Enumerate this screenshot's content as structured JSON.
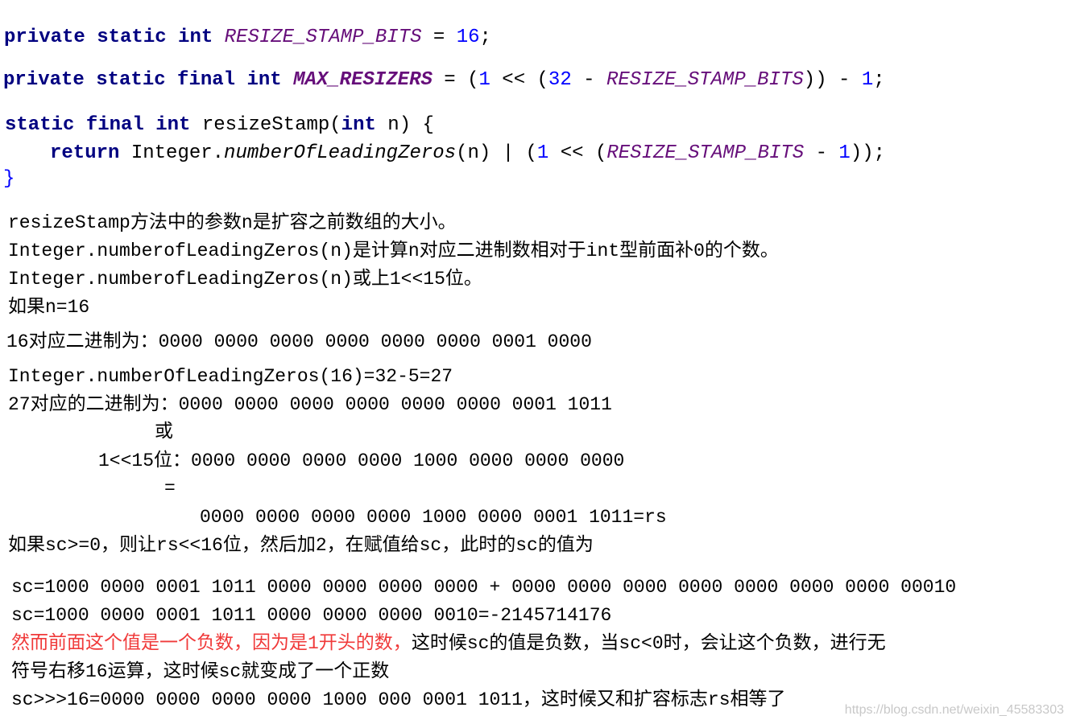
{
  "code": {
    "line1": {
      "kw": "private static int ",
      "const": "RESIZE_STAMP_BITS",
      "eq": " = ",
      "num": "16",
      "end": ";"
    },
    "line2": {
      "kw": "private static final int ",
      "const": "MAX_RESIZERS",
      "p1": " = (",
      "n1": "1",
      "p2": " << (",
      "n2": "32",
      "p3": " - ",
      "const2": "RESIZE_STAMP_BITS",
      "p4": ")) - ",
      "n3": "1",
      "end": ";"
    },
    "line3": {
      "kw": "static final int ",
      "name": "resizeStamp(",
      "kw2": "int",
      "rest": " n) {"
    },
    "line4": {
      "kw": "return ",
      "cls": "Integer.",
      "method": "numberOfLeadingZeros",
      "p1": "(n) | (",
      "n1": "1",
      "p2": " << (",
      "const": "RESIZE_STAMP_BITS",
      "p3": " - ",
      "n2": "1",
      "end": "));"
    },
    "line5": "}"
  },
  "text": [
    "resizeStamp方法中的参数n是扩容之前数组的大小。",
    "Integer.numberofLeadingZeros(n)是计算n对应二进制数相对于int型前面补0的个数。",
    "Integer.numberofLeadingZeros(n)或上1<<15位。",
    "如果n=16",
    "16对应二进制为：0000 0000 0000 0000 0000 0000 0001 0000",
    "Integer.numberOfLeadingZeros(16)=32-5=27",
    "27对应的二进制为：0000 0000 0000 0000 0000 0000 0001 1011",
    "或",
    "1<<15位：0000 0000 0000 0000 1000 0000 0000 0000",
    "=",
    "0000 0000 0000 0000 1000 0000 0001 1011=rs",
    "如果sc>=0，则让rs<<16位，然后加2，在赋值给sc，此时的sc的值为",
    "sc=1000 0000 0001 1011 0000 0000 0000 0000 + 0000 0000 0000 0000 0000 0000 0000 00010",
    "sc=1000 0000 0001 1011 0000 0000 0000 0010=-2145714176"
  ],
  "mixed": {
    "red": "然而前面这个值是一个负数，因为是1开头的数，",
    "black": "这时候sc的值是负数，当sc<0时，会让这个负数，进行无"
  },
  "text2": [
    "符号右移16运算，这时候sc就变成了一个正数",
    "sc>>>16=0000 0000 0000 0000 1000 000 0001 1011，这时候又和扩容标志rs相等了"
  ],
  "watermark": "https://blog.csdn.net/weixin_45583303",
  "colors": {
    "keyword": "#000080",
    "constant": "#660e7a",
    "number": "#0000ff",
    "highlight": "#f03a3a"
  }
}
